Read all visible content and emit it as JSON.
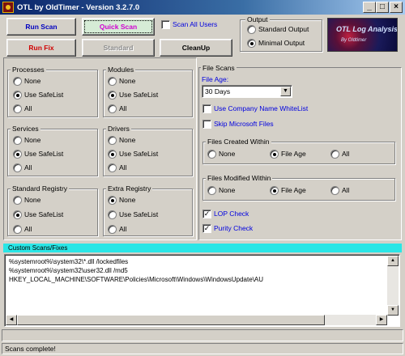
{
  "window": {
    "title": "OTL by OldTimer - Version 3.2.7.0"
  },
  "toolbar": {
    "run_scan": "Run Scan",
    "quick_scan": "Quick Scan",
    "run_fix": "Run Fix",
    "standard": "Standard",
    "cleanup": "CleanUp",
    "scan_all_users": "Scan All Users",
    "scan_all_users_checked": false
  },
  "output": {
    "title": "Output",
    "options": [
      "Standard Output",
      "Minimal Output"
    ],
    "selected": "Minimal Output"
  },
  "logo": {
    "line1": "OTL Log Analysis",
    "line2": "By Oldtimer"
  },
  "groups": {
    "processes": {
      "title": "Processes",
      "options": [
        "None",
        "Use SafeList",
        "All"
      ],
      "selected": "Use SafeList"
    },
    "modules": {
      "title": "Modules",
      "options": [
        "None",
        "Use SafeList",
        "All"
      ],
      "selected": "Use SafeList"
    },
    "services": {
      "title": "Services",
      "options": [
        "None",
        "Use SafeList",
        "All"
      ],
      "selected": "Use SafeList"
    },
    "drivers": {
      "title": "Drivers",
      "options": [
        "None",
        "Use SafeList",
        "All"
      ],
      "selected": "Use SafeList"
    },
    "standard_registry": {
      "title": "Standard Registry",
      "options": [
        "None",
        "Use SafeList",
        "All"
      ],
      "selected": "Use SafeList"
    },
    "extra_registry": {
      "title": "Extra Registry",
      "options": [
        "None",
        "Use SafeList",
        "All"
      ],
      "selected": "None"
    }
  },
  "file_scans": {
    "title": "File Scans",
    "file_age_label": "File Age:",
    "file_age_value": "30 Days",
    "use_company_whitelist": "Use Company Name WhiteList",
    "use_company_whitelist_checked": false,
    "skip_microsoft": "Skip Microsoft Files",
    "skip_microsoft_checked": false,
    "created_within": {
      "title": "Files Created Within",
      "options": [
        "None",
        "File Age",
        "All"
      ],
      "selected": "File Age"
    },
    "modified_within": {
      "title": "Files Modified Within",
      "options": [
        "None",
        "File Age",
        "All"
      ],
      "selected": "File Age"
    },
    "lop_check": "LOP Check",
    "lop_check_checked": true,
    "purity_check": "Purity Check",
    "purity_check_checked": true
  },
  "custom_scans": {
    "title": "Custom Scans/Fixes",
    "lines": [
      "%systemroot%\\system32\\*.dll /lockedfiles",
      "%systemroot%\\system32\\user32.dll /md5",
      "HKEY_LOCAL_MACHINE\\SOFTWARE\\Policies\\Microsoft\\Windows\\WindowsUpdate\\AU"
    ]
  },
  "status": {
    "text": "Scans complete!"
  },
  "colors": {
    "accent_cyan": "#2ae6e6",
    "title_blue": "#0a246a",
    "label_blue": "#0000e0"
  }
}
